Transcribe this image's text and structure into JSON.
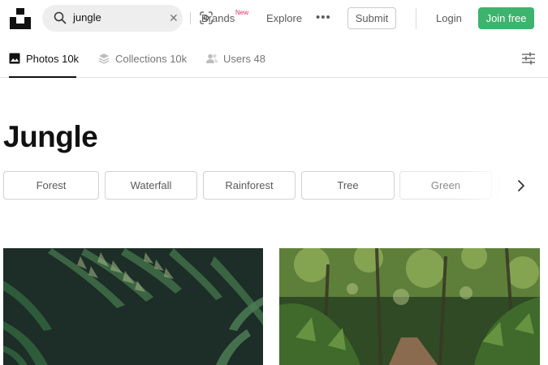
{
  "header": {
    "logo_icon": "unsplash-logo-icon",
    "search": {
      "value": "jungle",
      "icon": "search-icon",
      "clear_icon": "close-icon",
      "visual_search_icon": "visual-search-icon"
    },
    "nav": {
      "brands": "Brands",
      "brands_badge": "New",
      "explore": "Explore",
      "more": "•••"
    },
    "submit_label": "Submit",
    "login_label": "Login",
    "join_label": "Join free",
    "colors": {
      "join": "#3cb46e",
      "badge": "#e8305b"
    }
  },
  "tabs": [
    {
      "label": "Photos 10k",
      "icon": "image-icon",
      "active": true
    },
    {
      "label": "Collections 10k",
      "icon": "collections-icon",
      "active": false
    },
    {
      "label": "Users 48",
      "icon": "users-icon",
      "active": false
    }
  ],
  "filter_icon": "filter-sliders-icon",
  "page_title": "Jungle",
  "chips": [
    "Forest",
    "Waterfall",
    "Rainforest",
    "Tree",
    "Green"
  ],
  "chip_next_icon": "chevron-right-icon",
  "photos": [
    {
      "icon": "photo-ferns",
      "dominant_color": "#1e2f2a"
    },
    {
      "icon": "photo-jungle-path",
      "dominant_color": "#3f5a2e"
    }
  ]
}
